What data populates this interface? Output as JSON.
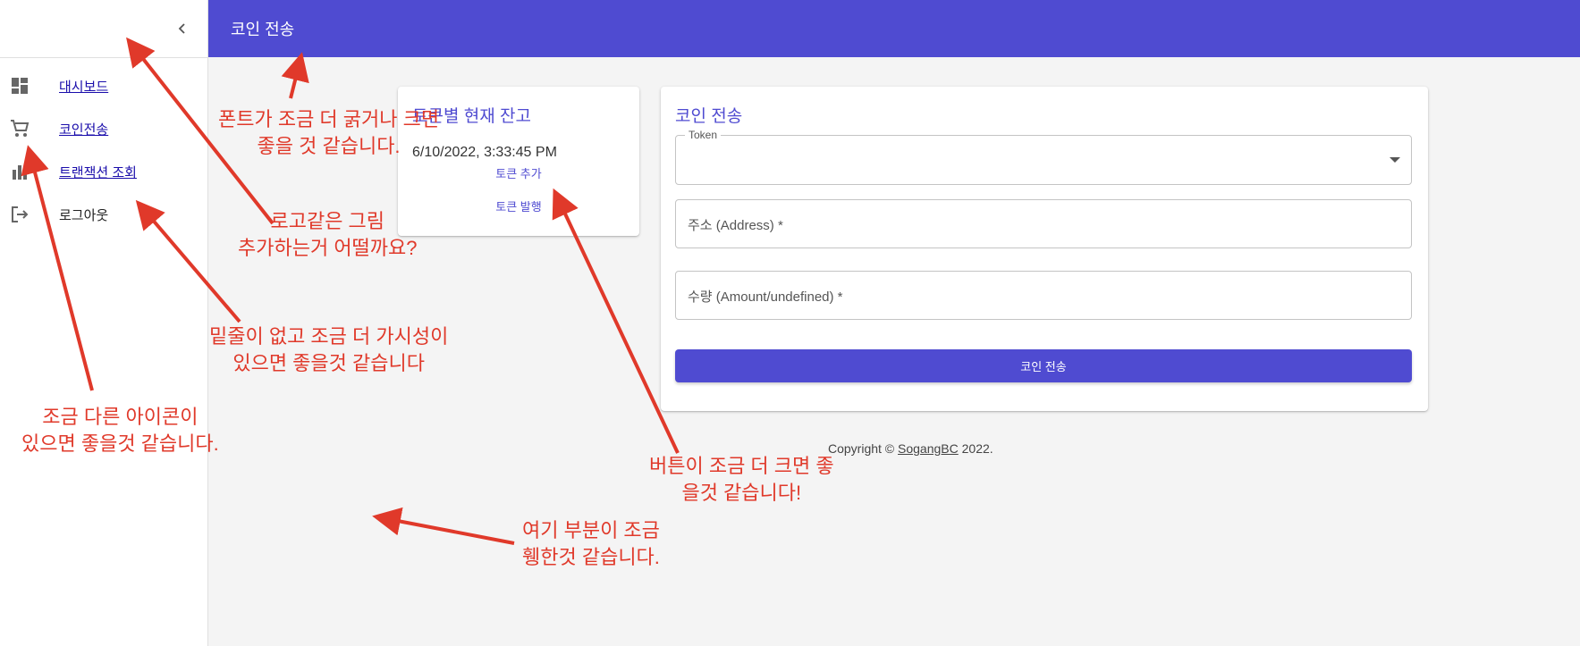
{
  "appbar": {
    "title": "코인 전송"
  },
  "sidebar": {
    "items": [
      {
        "label": "대시보드",
        "icon": "dashboard-icon"
      },
      {
        "label": "코인전송",
        "icon": "cart-icon"
      },
      {
        "label": "트랜잭션 조회",
        "icon": "bar-chart-icon"
      },
      {
        "label": "로그아웃",
        "icon": "logout-icon"
      }
    ]
  },
  "balance_card": {
    "title": "토큰별 현재 잔고",
    "timestamp": "6/10/2022, 3:33:45 PM",
    "add_token": "토큰 추가",
    "issue_token": "토큰 발행"
  },
  "transfer_card": {
    "title": "코인 전송",
    "token_label": "Token",
    "address_placeholder": "주소 (Address) *",
    "amount_placeholder": "수량 (Amount/undefined) *",
    "submit": "코인 전송"
  },
  "footer": {
    "prefix": "Copyright © ",
    "link": "SogangBC",
    "suffix": " 2022."
  },
  "annotations": {
    "font": "폰트가 조금 더 굵거나 크면\n좋을 것 같습니다.",
    "logo": "로고같은 그림\n추가하는거 어떨까요?",
    "underline": "밑줄이 없고 조금 더 가시성이\n있으면 좋을것 같습니다",
    "icon": "조금 다른 아이콘이\n있으면 좋을것 같습니다.",
    "button": "버튼이 조금 더 크면 좋\n을것 같습니다!",
    "empty": "여기 부분이 조금\n휑한것 같습니다."
  },
  "colors": {
    "primary": "#4f4bd1",
    "annotation": "#e0392a",
    "background": "#f4f4f4"
  }
}
